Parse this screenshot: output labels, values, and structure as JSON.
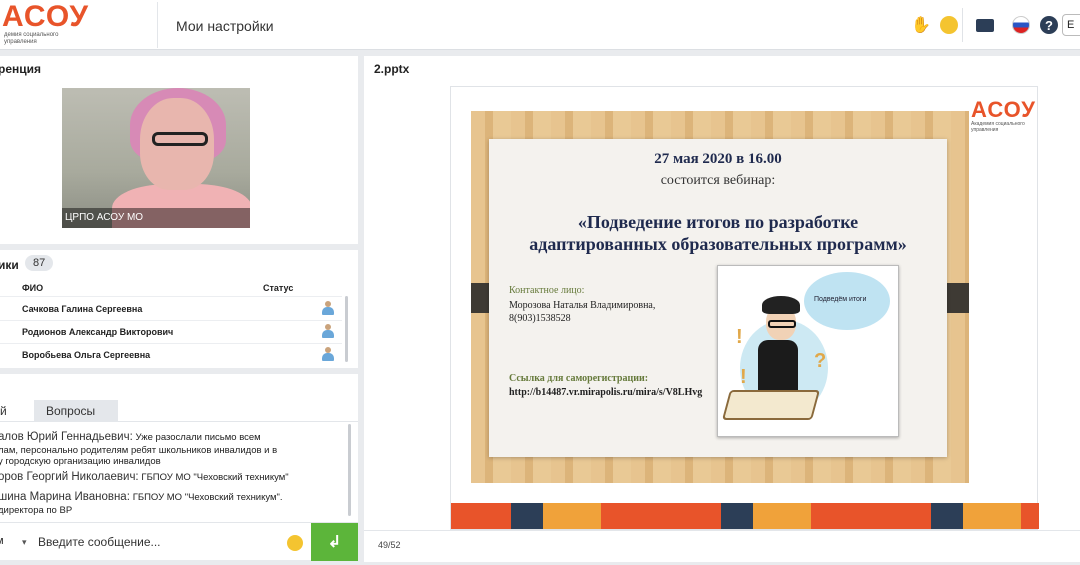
{
  "topbar": {
    "logo_text": "АСОУ",
    "logo_subtitle": "демия социального управления",
    "settings_tab": "Мои настройки",
    "user_btn_text": "Е"
  },
  "conference": {
    "title": "ренция",
    "video_label": "ЦРПО АСОУ МО"
  },
  "participants": {
    "title": "ики",
    "count": "87",
    "col_fio": "ФИО",
    "col_status": "Статус",
    "rows": [
      {
        "name": "Сачкова Галина Сергеевна"
      },
      {
        "name": "Родионов Александр Викторович"
      },
      {
        "name": "Воробьева Ольга Сергеевна"
      }
    ]
  },
  "chat": {
    "tab_active": "й",
    "tab_questions": "Вопросы",
    "messages": [
      {
        "author": "алов Юрий Геннадьевич:",
        "text": "Уже разослали письмо всем"
      },
      {
        "author": "",
        "text": "лам, персонально  родителям ребят школьников инвалидов и в"
      },
      {
        "author": "",
        "text": "у городскую организацию инвалидов"
      },
      {
        "author": "оров Георгий Николаевич:",
        "text": "ГБПОУ МО \"Чеховский техникум\""
      },
      {
        "author": "шина Марина Ивановна:",
        "text": "ГБПОУ МО \"Чеховский техникум\"."
      },
      {
        "author": "",
        "text": "директора по ВР"
      }
    ],
    "mode": "м",
    "input_placeholder": "Введите сообщение...",
    "send_symbol": "↲"
  },
  "presentation": {
    "file_name": "2.pptx",
    "page_counter": "49/52",
    "slide": {
      "logo": "АСОУ",
      "logo_sub": "Академия социального управления",
      "date": "27 мая 2020 в 16.00",
      "subtitle": "состоится вебинар:",
      "title_line1": "«Подведение итогов по разработке",
      "title_line2": "адаптированных образовательных программ»",
      "contact_heading": "Контактное лицо:",
      "contact_name": "Морозова Наталья Владимировна,",
      "contact_phone": "8(903)1538528",
      "link_heading": "Ссылка для саморегистрации:",
      "link": "http://b14487.vr.mirapolis.ru/mira/s/V8LHvg",
      "bubble_text": "Подведём итоги"
    }
  },
  "icons": [
    "hand-icon",
    "smile-icon",
    "folder-icon",
    "flag-ru-icon",
    "help-icon",
    "user-status-icon",
    "emoji-icon",
    "send-icon"
  ],
  "colors": {
    "brand": "#e8542a",
    "send": "#5cb53a",
    "dark": "#2c3e57"
  }
}
